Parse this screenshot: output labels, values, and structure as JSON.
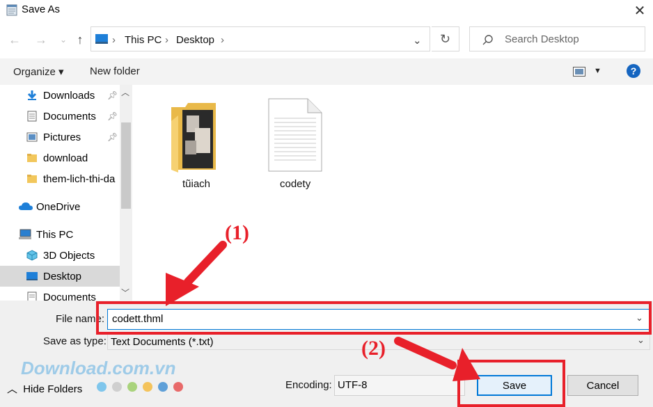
{
  "window": {
    "title": "Save As"
  },
  "address": {
    "crumbs": [
      "This PC",
      "Desktop"
    ]
  },
  "search": {
    "placeholder": "Search Desktop"
  },
  "toolbar": {
    "organize": "Organize",
    "new_folder": "New folder"
  },
  "sidebar": {
    "items": [
      {
        "label": "Downloads",
        "icon": "download-arrow-icon",
        "pinned": true
      },
      {
        "label": "Documents",
        "icon": "document-icon",
        "pinned": true
      },
      {
        "label": "Pictures",
        "icon": "pictures-icon",
        "pinned": true
      },
      {
        "label": "download",
        "icon": "folder-icon",
        "pinned": false
      },
      {
        "label": "them-lich-thi-da",
        "icon": "folder-icon",
        "pinned": false
      },
      {
        "label": "OneDrive",
        "icon": "cloud-icon",
        "pinned": false
      },
      {
        "label": "This PC",
        "icon": "computer-icon",
        "pinned": false
      },
      {
        "label": "3D Objects",
        "icon": "cube-icon",
        "pinned": false
      },
      {
        "label": "Desktop",
        "icon": "desktop-icon",
        "pinned": false,
        "selected": true
      },
      {
        "label": "Documents",
        "icon": "document-icon",
        "pinned": false
      }
    ]
  },
  "files": [
    {
      "name": "tũiach",
      "type": "folder"
    },
    {
      "name": "codety",
      "type": "text-file"
    }
  ],
  "form": {
    "file_name_label": "File name:",
    "file_name_value": "codett.thml",
    "save_type_label": "Save as type:",
    "save_type_value": "Text Documents (*.txt)",
    "encoding_label": "Encoding:",
    "encoding_value": "UTF-8",
    "hide_folders": "Hide Folders",
    "save_label": "Save",
    "cancel_label": "Cancel"
  },
  "annotations": {
    "step1": "(1)",
    "step2": "(2)",
    "color": "#e8202a"
  },
  "watermark": {
    "text": "Download.com.vn",
    "dot_colors": [
      "#7fc6ec",
      "#cfcfcf",
      "#a9d37c",
      "#f4c35b",
      "#5fa0d8",
      "#e86a6a"
    ]
  }
}
